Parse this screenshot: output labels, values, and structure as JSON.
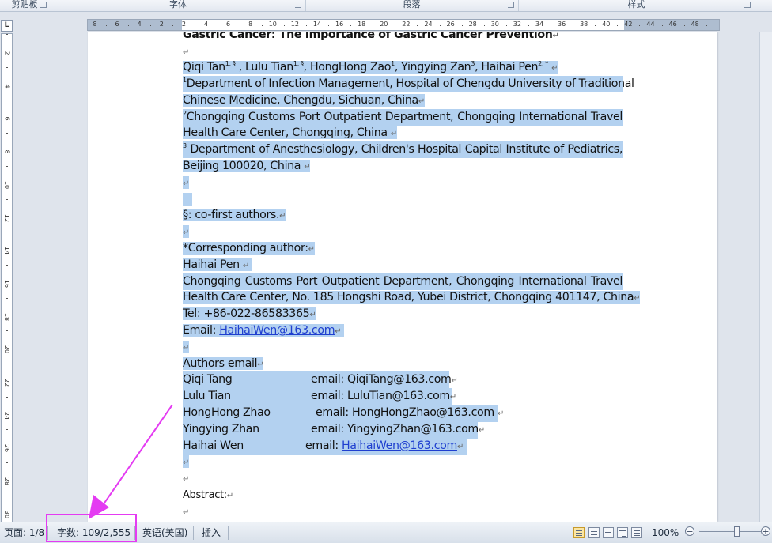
{
  "ribbon": {
    "groups": [
      {
        "name": "clipboard",
        "label": "剪贴板"
      },
      {
        "name": "font",
        "label": "字体"
      },
      {
        "name": "paragraph",
        "label": "段落"
      },
      {
        "name": "styles",
        "label": "样式"
      }
    ]
  },
  "ruler": {
    "corner_label": "L",
    "h_ticks": [
      "8",
      "6",
      "4",
      "2",
      "2",
      "4",
      "6",
      "8",
      "10",
      "12",
      "14",
      "16",
      "18",
      "20",
      "22",
      "24",
      "26",
      "28",
      "30",
      "32",
      "34",
      "36",
      "38",
      "40",
      "42",
      "44",
      "46",
      "48"
    ],
    "v_ticks": [
      "2",
      "4",
      "6",
      "8",
      "10",
      "12",
      "14",
      "16",
      "18",
      "20",
      "22",
      "24",
      "26",
      "28",
      "30"
    ]
  },
  "document": {
    "title": "Gastric Cancer: The Importance of Gastric Cancer Prevention",
    "authors": {
      "names": [
        {
          "name": "Qiqi Tan",
          "sup": "1, §"
        },
        {
          "name": "Lulu Tian",
          "sup": "1, §"
        },
        {
          "name": "HongHong Zao",
          "sup": "1"
        },
        {
          "name": "Yingying Zan",
          "sup": "3"
        },
        {
          "name": "Haihai Pen",
          "sup": "2, *"
        }
      ]
    },
    "affiliation1_sup": "1",
    "affiliation1_line1": "Department of Infection Management, Hospital of Chengdu University of Traditional",
    "affiliation1_line2": "Chinese Medicine, Chengdu, Sichuan, China",
    "affiliation2_sup": "2",
    "affiliation2_line1": "Chongqing Customs Port Outpatient Department, Chongqing International Travel",
    "affiliation2_line2": "Health Care Center, Chongqing, China",
    "affiliation3_sup": "3",
    "affiliation3_line1": "Department of Anesthesiology, Children's Hospital Capital Institute of Pediatrics,",
    "affiliation3_line2": "Beijing 100020, China",
    "cofirst": "§: co-first authors.",
    "corresponding_label": "*Corresponding author:",
    "corresponding_name": "Haihai Pen",
    "corresponding_addr1": "Chongqing Customs Port Outpatient Department, Chongqing International Travel",
    "corresponding_addr2": "Health Care Center, No. 185 Hongshi Road, Yubei District, Chongqing 401147, China",
    "tel": "Tel: +86-022-86583365",
    "email_label": "Email: ",
    "email_link": "HaihaiWen@163.com",
    "authors_email_label": "Authors email",
    "author_emails": [
      {
        "name": "Qiqi Tang",
        "email": "email: QiqiTang@163.com"
      },
      {
        "name": "Lulu Tian",
        "email": "email: LuluTian@163.com"
      },
      {
        "name": "HongHong Zhao",
        "email": "email: HongHongZhao@163.com"
      },
      {
        "name": "Yingying Zhan",
        "email": "email: YingyingZhan@163.com"
      },
      {
        "name": "Haihai Wen",
        "email_prefix": "email: ",
        "email_link": "HaihaiWen@163.com"
      }
    ],
    "abstract_label": "Abstract:",
    "para_mark": "↵"
  },
  "status": {
    "page": "页面: 1/8",
    "word_count": "字数: 109/2,555",
    "language": "英语(美国)",
    "insert_mode": "插入",
    "zoom": "100%",
    "zoom_minus": "−",
    "zoom_plus": "+"
  },
  "colors": {
    "selection": "#b3d1f0",
    "annotation": "#e43bf2",
    "link": "#1f3fcf"
  }
}
